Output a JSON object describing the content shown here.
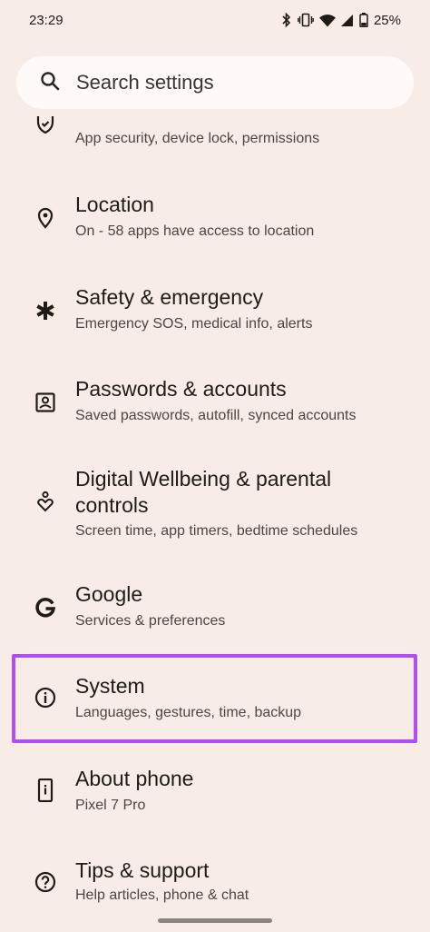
{
  "status_bar": {
    "time": "23:29",
    "battery": "25%",
    "icons": [
      "bluetooth-icon",
      "vibrate-icon",
      "wifi-icon",
      "signal-icon",
      "battery-icon"
    ]
  },
  "search": {
    "label": "Search settings"
  },
  "partial_item": {
    "subtitle": "App security, device lock, permissions"
  },
  "items": [
    {
      "title": "Location",
      "subtitle": "On - 58 apps have access to location",
      "icon": "location-pin-icon"
    },
    {
      "title": "Safety & emergency",
      "subtitle": "Emergency SOS, medical info, alerts",
      "icon": "asterisk-icon"
    },
    {
      "title": "Passwords & accounts",
      "subtitle": "Saved passwords, autofill, synced accounts",
      "icon": "account-box-icon"
    },
    {
      "title_line1": "Digital Wellbeing & parental",
      "title_line2": "controls",
      "subtitle": "Screen time, app timers, bedtime schedules",
      "icon": "wellbeing-icon"
    },
    {
      "title": "Google",
      "subtitle": "Services & preferences",
      "icon": "google-g-icon"
    },
    {
      "title": "System",
      "subtitle": "Languages, gestures, time, backup",
      "icon": "info-icon"
    },
    {
      "title": "About phone",
      "subtitle": "Pixel 7 Pro",
      "icon": "phone-info-icon"
    },
    {
      "title": "Tips & support",
      "subtitle": "Help articles, phone & chat",
      "icon": "help-icon"
    }
  ],
  "colors": {
    "background": "#f8ede6",
    "search_background": "#fffaf7",
    "highlight_border": "#b04ef0"
  }
}
